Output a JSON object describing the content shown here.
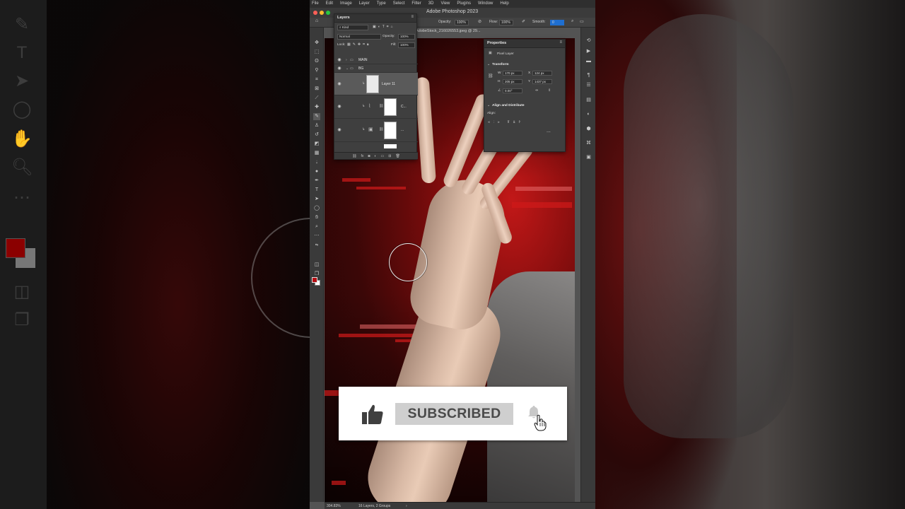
{
  "menu": {
    "items": [
      "File",
      "Edit",
      "Image",
      "Layer",
      "Type",
      "Select",
      "Filter",
      "3D",
      "View",
      "Plugins",
      "Window",
      "Help"
    ]
  },
  "window": {
    "title": "Adobe Photoshop 2023"
  },
  "options_bar": {
    "opacity_label": "Opacity:",
    "opacity_value": "100%",
    "flow_label": "Flow:",
    "flow_value": "100%",
    "smooth_label": "Smooth:",
    "smooth_value": "0"
  },
  "document_tab": {
    "label": "AdobeStock_216026553.jpeg @ 29..."
  },
  "layers_panel": {
    "tab_label": "Layers",
    "filter_kind": "Kind",
    "blend_mode": "Normal",
    "opacity_label": "Opacity:",
    "opacity_value": "100%",
    "lock_label": "Lock:",
    "fill_label": "Fill:",
    "fill_value": "100%",
    "groups": [
      {
        "name": "MAIN"
      },
      {
        "name": "BG"
      }
    ],
    "layers": [
      {
        "name": "Layer 11",
        "selected": true
      },
      {
        "name": "C...",
        "selected": false
      },
      {
        "name": "...",
        "selected": false
      }
    ]
  },
  "properties_panel": {
    "tab_label": "Properties",
    "layer_type": "Pixel Layer",
    "transform_label": "Transform",
    "w_label": "W",
    "w_value": "170 px",
    "x_label": "X",
    "x_value": "124 px",
    "h_label": "H",
    "h_value": "205 px",
    "y_label": "Y",
    "y_value": "1437 px",
    "angle_value": "0.00°",
    "align_section": "Align and Distribute",
    "align_label": "Align:",
    "more_label": "..."
  },
  "status_bar": {
    "zoom": "304.83%",
    "info": "16 Layers, 2 Groups"
  },
  "subscribe_overlay": {
    "button_label": "SUBSCRIBED",
    "icons": [
      "thumbs-up-icon",
      "bell-icon",
      "hand-pointer-icon"
    ]
  },
  "colors": {
    "foreground_swatch": "#b50d12",
    "background_swatch": "#ffffff",
    "accent_blue": "#1f6fd1"
  }
}
